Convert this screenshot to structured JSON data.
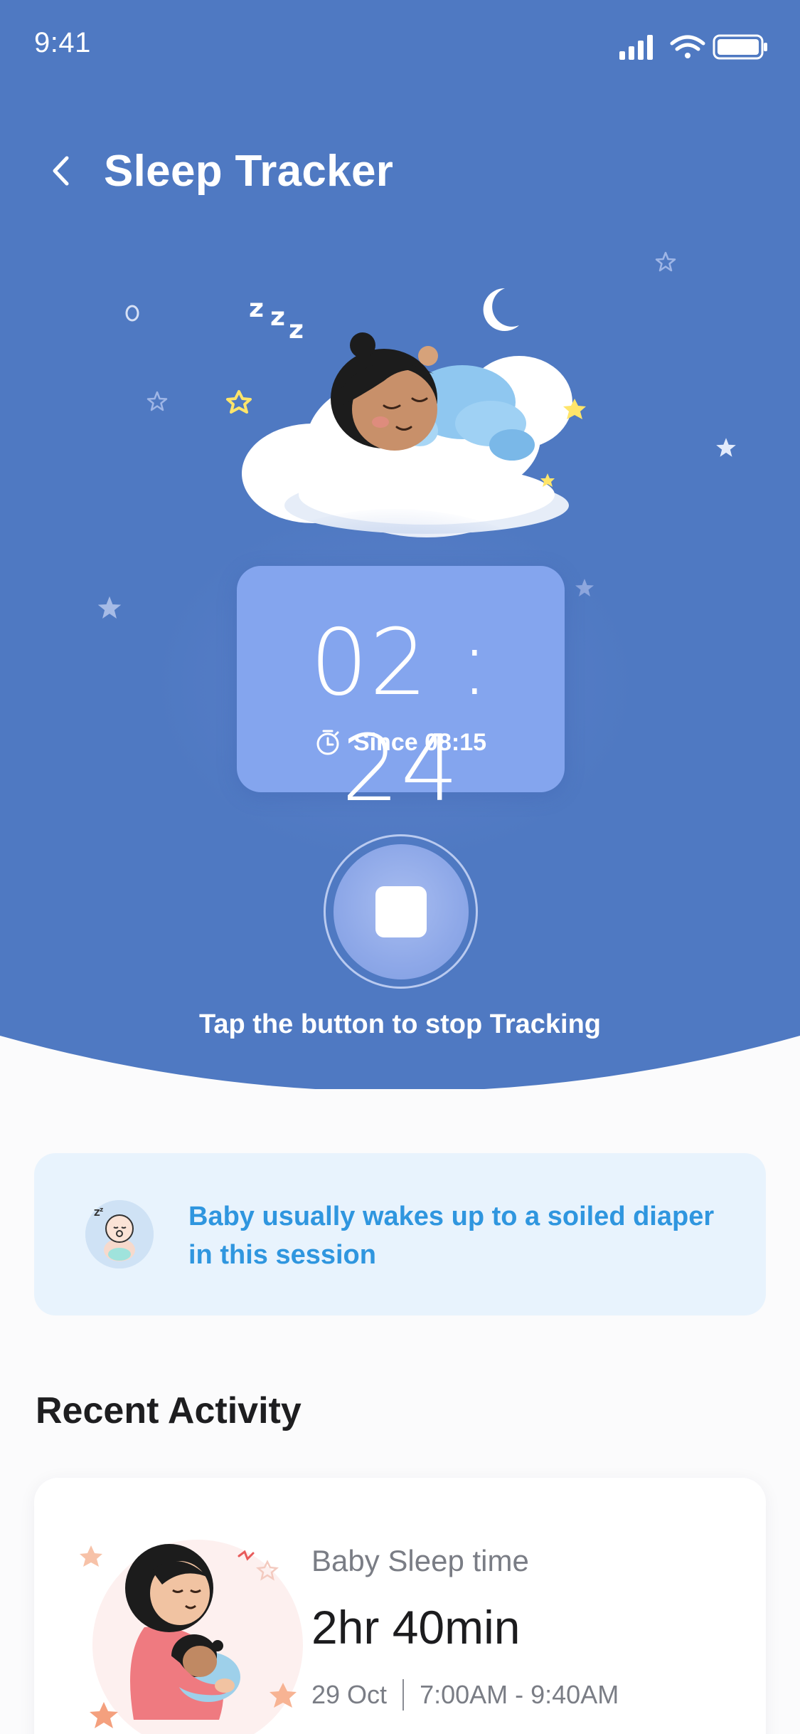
{
  "status_bar": {
    "time": "9:41",
    "icons": [
      "signal-icon",
      "wifi-icon",
      "battery-icon"
    ]
  },
  "header": {
    "title": "Sleep Tracker",
    "back_icon": "chevron-left-icon"
  },
  "timer": {
    "value": "02 : 24",
    "since_label": "Since 08:15",
    "since_icon": "stopwatch-icon"
  },
  "stop_button": {
    "icon": "stop-icon"
  },
  "hint": "Tap the button to stop Tracking",
  "tip": {
    "text": "Baby usually wakes up to a soiled diaper in this session",
    "icon": "baby-avatar-icon"
  },
  "recent_activity": {
    "title": "Recent Activity",
    "items": [
      {
        "label": "Baby Sleep time",
        "duration": "2hr 40min",
        "date": "29 Oct",
        "time_range": "7:00AM - 9:40AM"
      }
    ]
  },
  "colors": {
    "hero_bg": "#4f79c2",
    "timer_card": "#84a5ee",
    "tip_bg": "#e8f3fd",
    "tip_text": "#2f96df",
    "page_bg": "#fbfbfc"
  }
}
